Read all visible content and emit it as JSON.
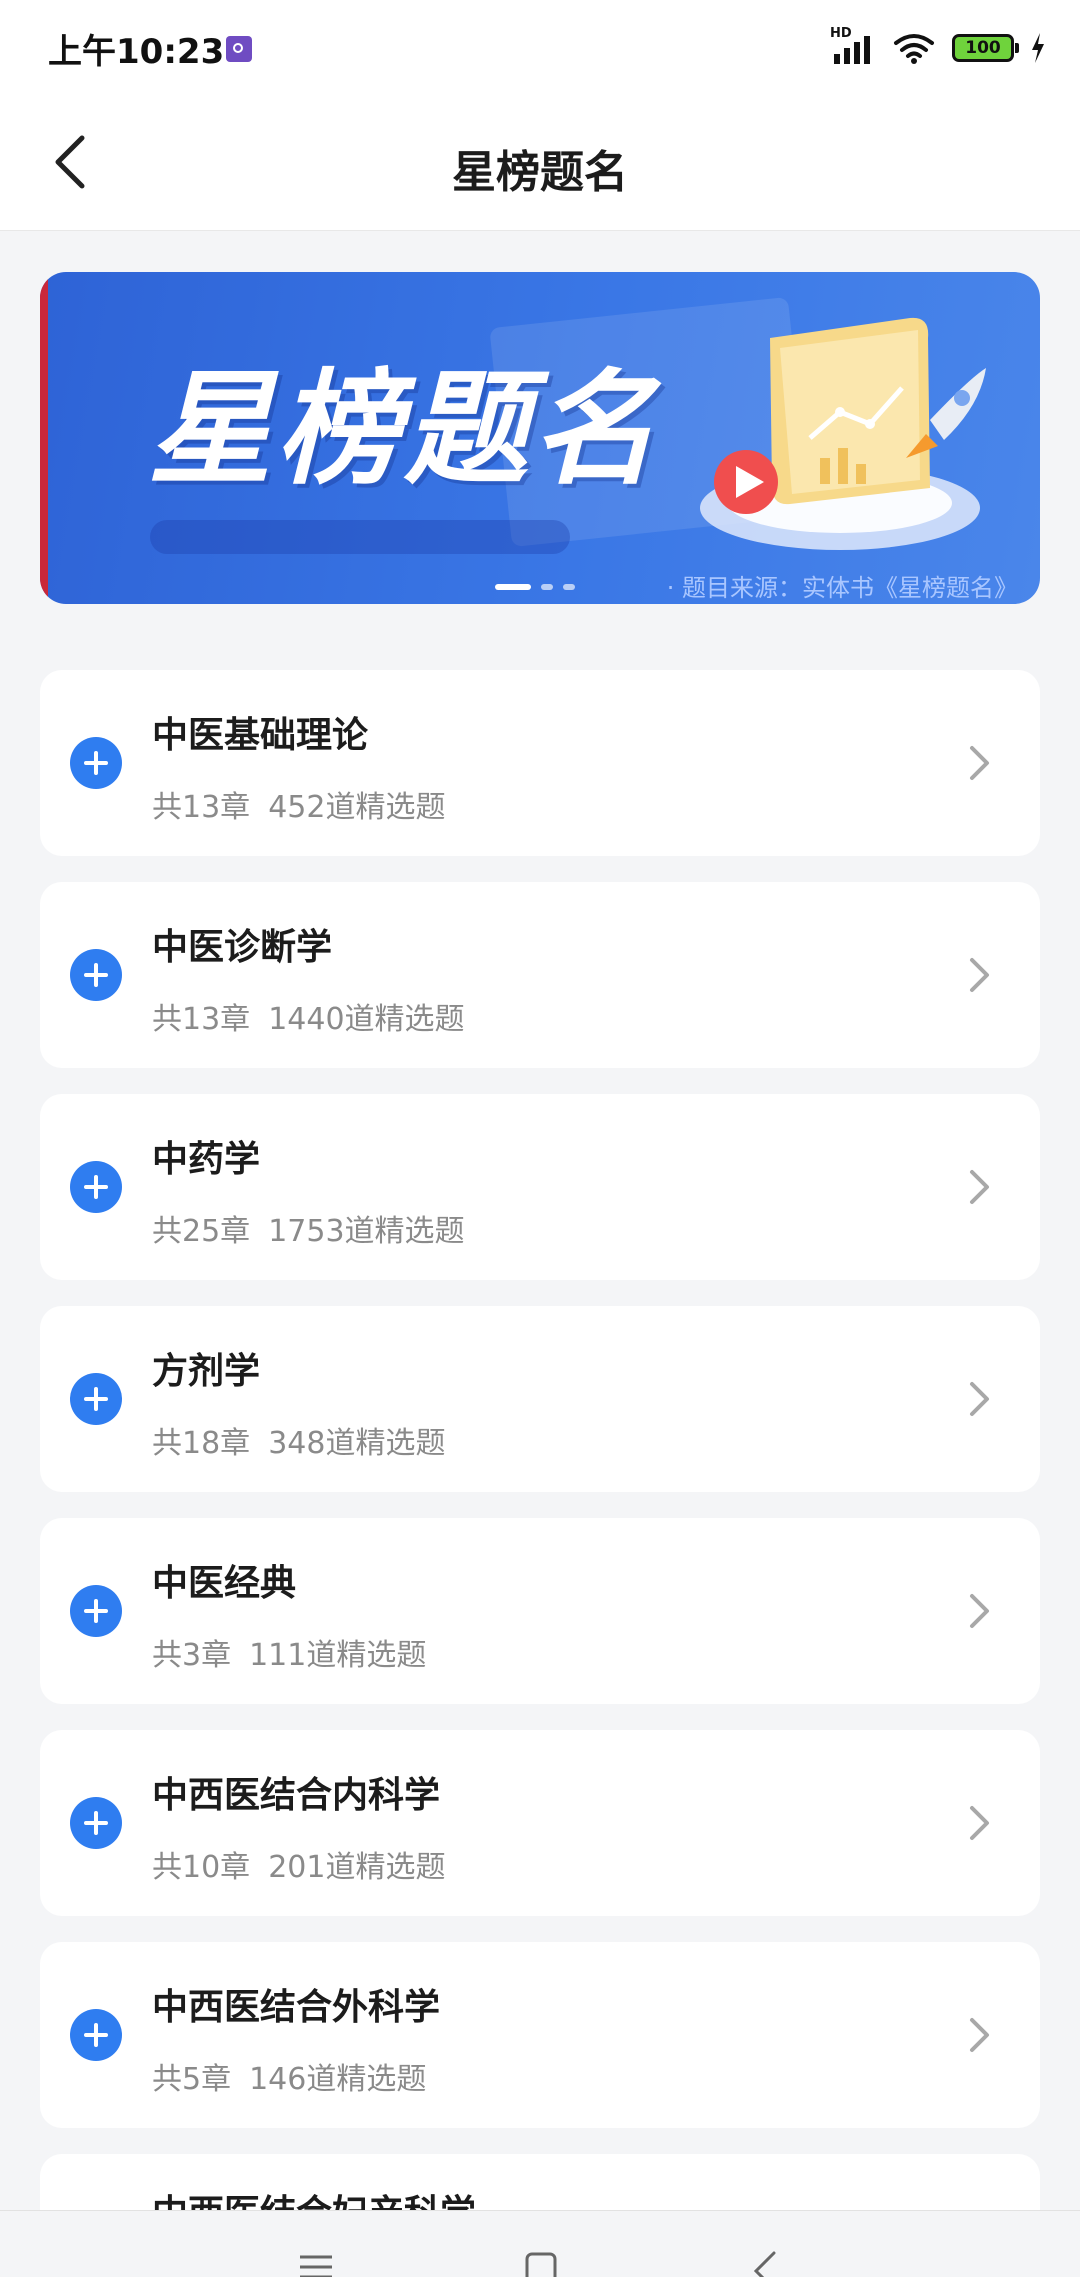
{
  "status_bar": {
    "time": "上午10:23",
    "network_label": "HD",
    "battery": "100"
  },
  "header": {
    "title": "星榜题名"
  },
  "banner": {
    "title": "星榜题名",
    "source": "· 题目来源：实体书《星榜题名》",
    "slides": 3,
    "active_slide": 1
  },
  "subjects": [
    {
      "name": "中医基础理论",
      "chapters": "共13章",
      "questions": "452道精选题"
    },
    {
      "name": "中医诊断学",
      "chapters": "共13章",
      "questions": "1440道精选题"
    },
    {
      "name": "中药学",
      "chapters": "共25章",
      "questions": "1753道精选题"
    },
    {
      "name": "方剂学",
      "chapters": "共18章",
      "questions": "348道精选题"
    },
    {
      "name": "中医经典",
      "chapters": "共3章",
      "questions": "111道精选题"
    },
    {
      "name": "中西医结合内科学",
      "chapters": "共10章",
      "questions": "201道精选题"
    },
    {
      "name": "中西医结合外科学",
      "chapters": "共5章",
      "questions": "146道精选题"
    },
    {
      "name": "中西医结合妇产科学",
      "chapters": "",
      "questions": ""
    }
  ],
  "colors": {
    "accent": "#2f7df0",
    "banner_bg": "#3a77e6",
    "background": "#f4f5f7"
  }
}
